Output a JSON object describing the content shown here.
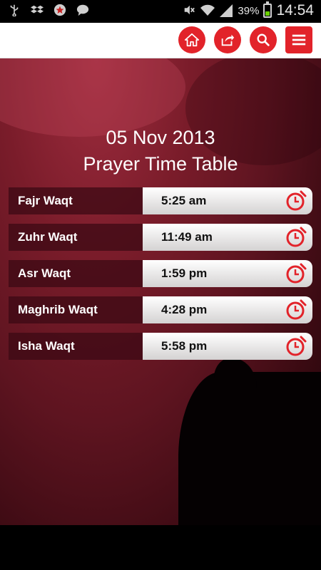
{
  "status_bar": {
    "left_icons": [
      "usb-icon",
      "dropbox-icon",
      "star-icon",
      "chat-icon"
    ],
    "battery": "39%",
    "time": "14:54"
  },
  "toolbar": {
    "buttons": [
      "home-icon",
      "share-icon",
      "search-icon",
      "menu-icon"
    ],
    "accent": "#e2232a"
  },
  "header": {
    "date": "05 Nov 2013",
    "title": "Prayer Time Table"
  },
  "prayers": [
    {
      "label": "Fajr Waqt",
      "time": "5:25 am"
    },
    {
      "label": "Zuhr Waqt",
      "time": "11:49 am"
    },
    {
      "label": "Asr Waqt",
      "time": "1:59 pm"
    },
    {
      "label": "Maghrib Waqt",
      "time": "4:28 pm"
    },
    {
      "label": "Isha Waqt",
      "time": "5:58 pm"
    }
  ]
}
